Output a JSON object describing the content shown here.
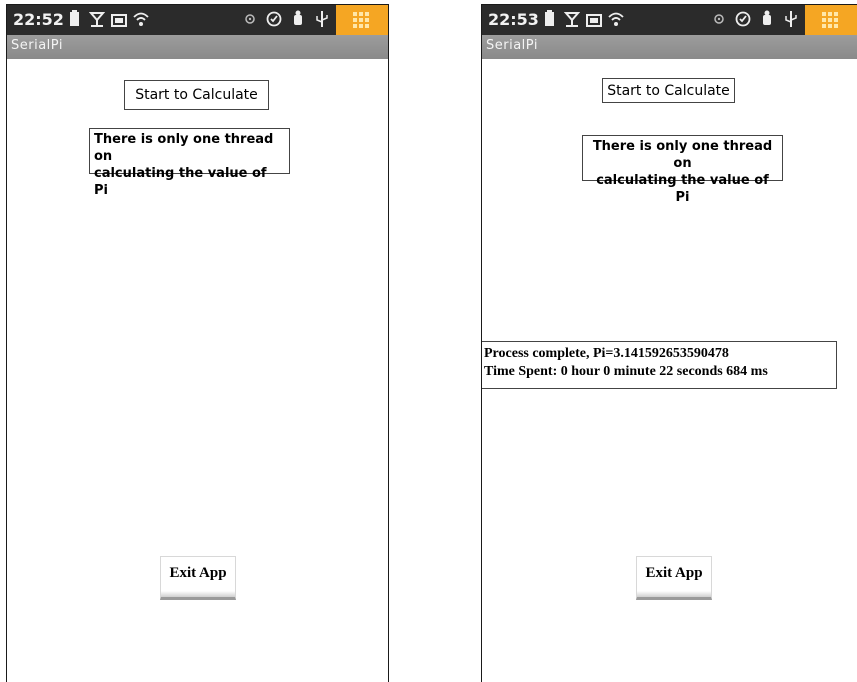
{
  "screens": [
    {
      "status_time": "22:52",
      "app_title": "SerialPi",
      "start_button": "Start to Calculate",
      "thread_info_line1": "There is only one thread on",
      "thread_info_line2": "calculating the value of Pi",
      "exit_button": "Exit App"
    },
    {
      "status_time": "22:53",
      "app_title": "SerialPi",
      "start_button": "Start to Calculate",
      "thread_info_line1": "There is only one thread on",
      "thread_info_line2": "calculating the value of Pi",
      "result_line1": "Process complete, Pi=3.141592653590478",
      "result_line2": "Time Spent: 0 hour 0 minute 22 seconds 684 ms",
      "exit_button": "Exit App"
    }
  ],
  "status_icons": [
    "battery-icon",
    "signal-icon",
    "hd-icon",
    "wifi-icon",
    "alarm-icon",
    "shield-icon",
    "android-icon",
    "usb-icon",
    "app-grid-icon"
  ],
  "colors": {
    "status_bar": "#2b2b2b",
    "title_bar": "#939393",
    "grid_button": "#f5a623"
  }
}
